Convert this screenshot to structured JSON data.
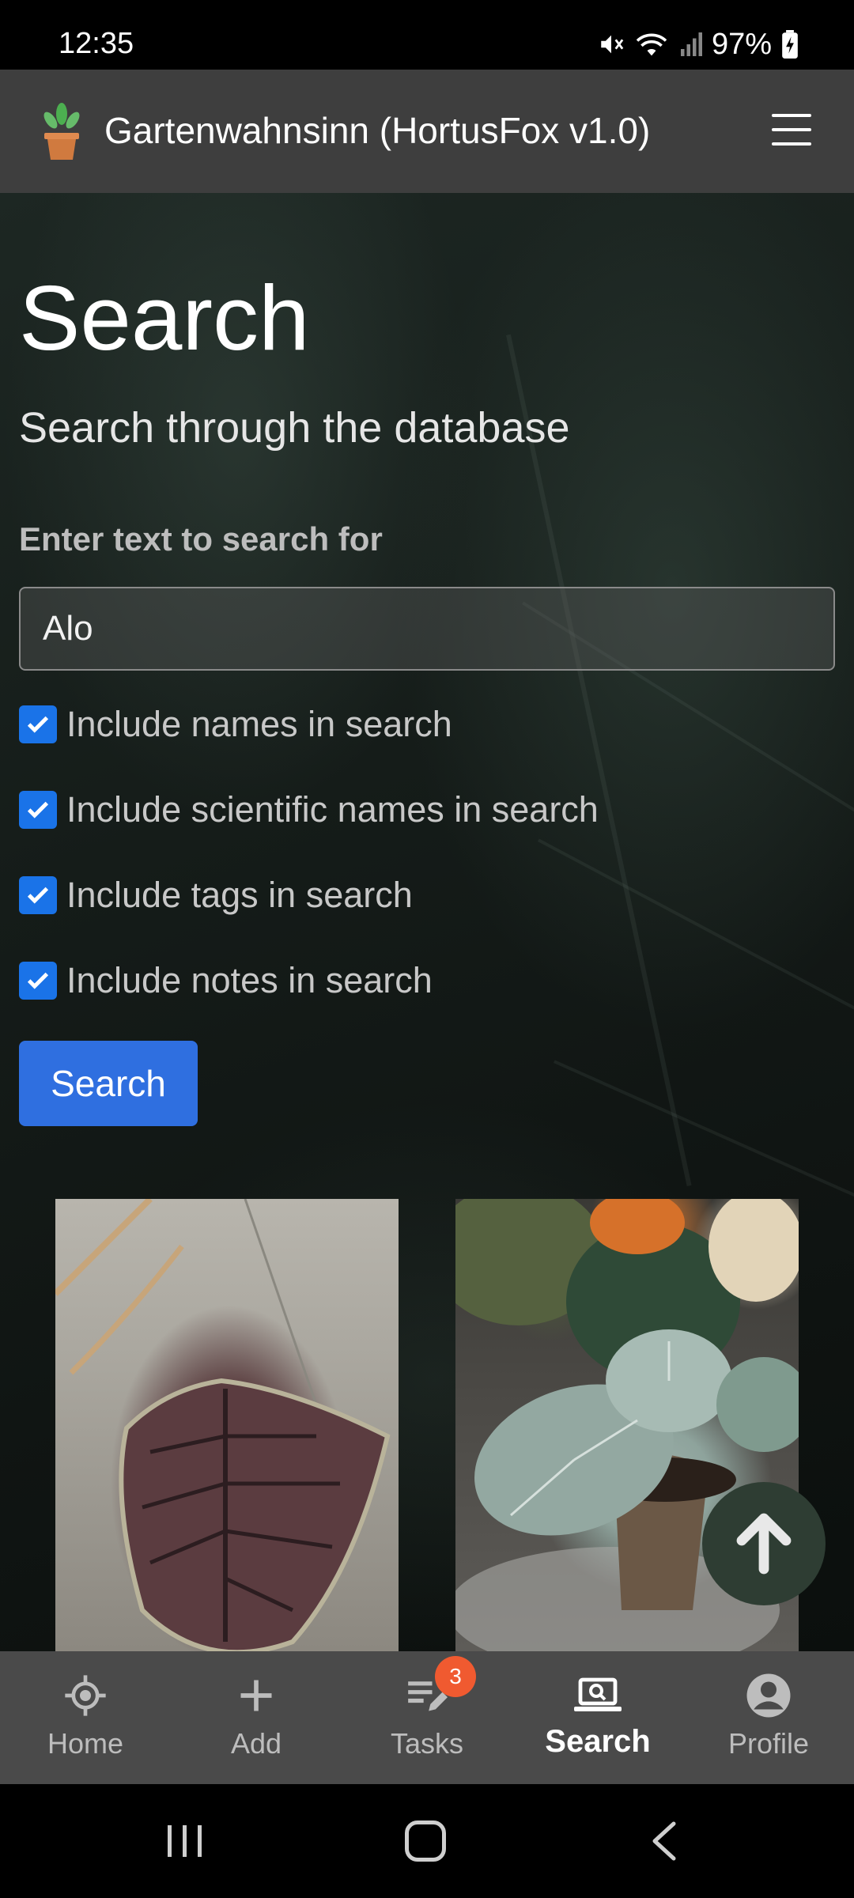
{
  "status_bar": {
    "time": "12:35",
    "battery": "97%",
    "icons": [
      "mute-icon",
      "wifi-icon",
      "signal-icon",
      "battery-icon"
    ]
  },
  "app_bar": {
    "title": "Gartenwahnsinn (HortusFox v1.0)",
    "logo": "potted-plant-logo",
    "menu": "hamburger-menu-icon"
  },
  "page": {
    "heading": "Search",
    "subtitle": "Search through the database",
    "input_label": "Enter text to search for",
    "input_value": "Alo",
    "options": [
      {
        "label": "Include names in search",
        "checked": true
      },
      {
        "label": "Include scientific names in search",
        "checked": true
      },
      {
        "label": "Include tags in search",
        "checked": true
      },
      {
        "label": "Include notes in search",
        "checked": true
      }
    ],
    "search_button": "Search"
  },
  "results": [
    {
      "image": "alocasia-dark-leaf-photo"
    },
    {
      "image": "alocasia-silver-leaf-with-pumpkins-photo"
    }
  ],
  "fab": "arrow-up-icon",
  "bottom_nav": {
    "items": [
      {
        "label": "Home",
        "icon": "crosshair-icon"
      },
      {
        "label": "Add",
        "icon": "plus-icon"
      },
      {
        "label": "Tasks",
        "icon": "task-edit-icon",
        "badge": "3"
      },
      {
        "label": "Search",
        "icon": "laptop-search-icon",
        "active": true
      },
      {
        "label": "Profile",
        "icon": "user-icon"
      }
    ]
  },
  "colors": {
    "accent": "#2f6fe0",
    "checkbox": "#1a73e8",
    "header": "#3e3e3e",
    "nav": "#4a4a4a",
    "badge": "#f05a30",
    "fab": "#2e3d33"
  }
}
